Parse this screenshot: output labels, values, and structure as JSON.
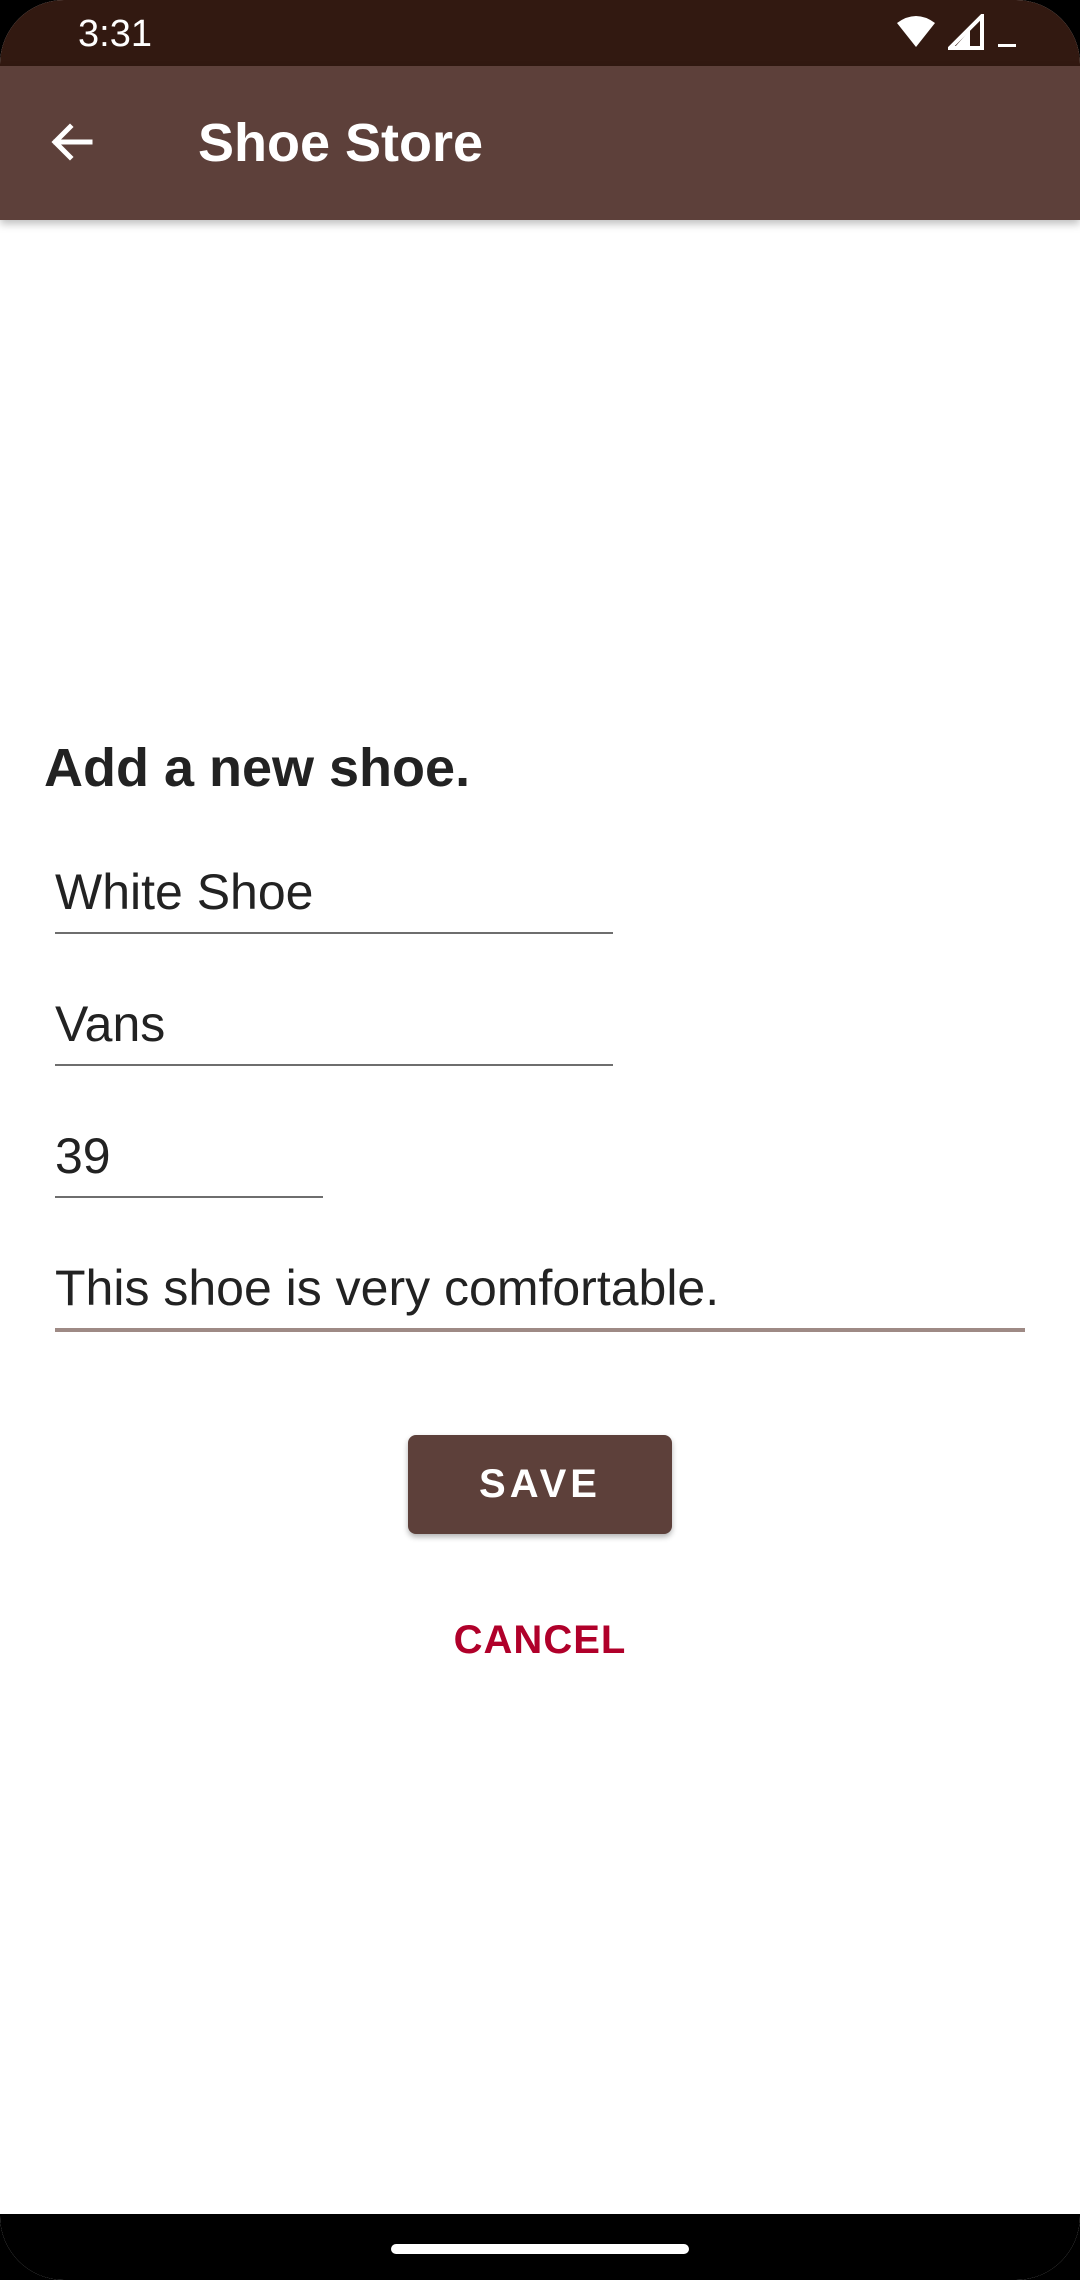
{
  "status_bar": {
    "time": "3:31",
    "icons": [
      "wifi-icon",
      "cell-signal-icon",
      "battery-icon"
    ]
  },
  "app_bar": {
    "back_icon": "arrow-back-icon",
    "title": "Shoe Store"
  },
  "form": {
    "heading": "Add a new shoe.",
    "name_value": "White Shoe",
    "company_value": "Vans",
    "size_value": "39",
    "description_value": "This shoe is very comfortable."
  },
  "actions": {
    "save_label": "SAVE",
    "cancel_label": "CANCEL"
  },
  "colors": {
    "status_bar": "#321911",
    "primary": "#5d403a",
    "accent_text": "#b0002a"
  }
}
